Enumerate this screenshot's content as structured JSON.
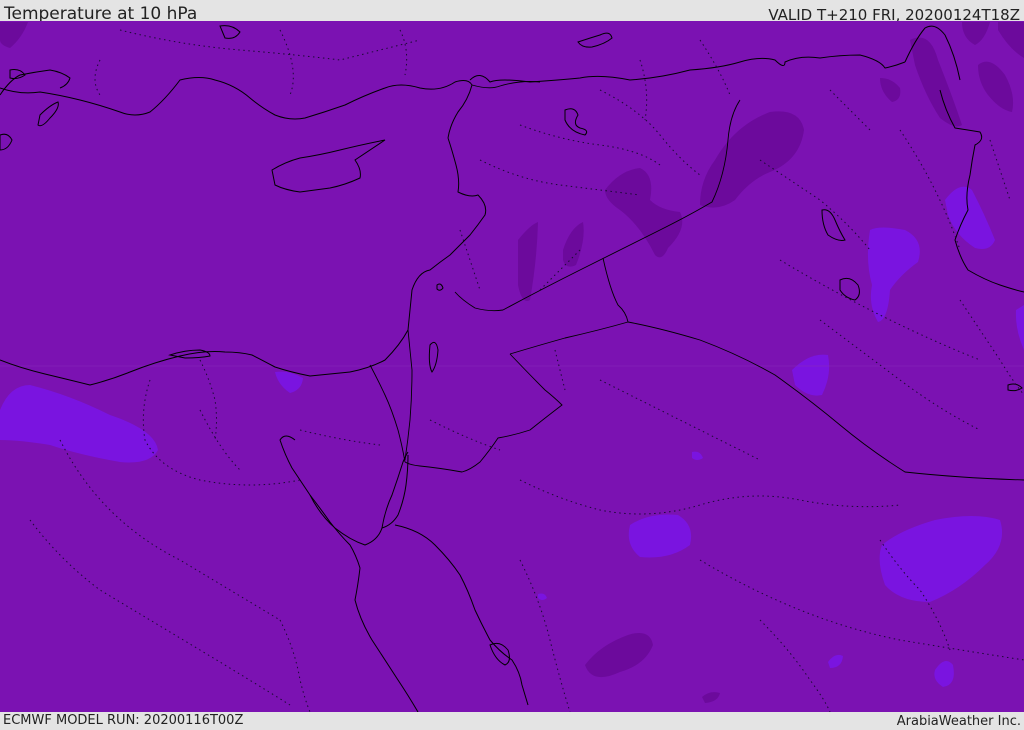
{
  "header": {
    "title": "Temperature at 10 hPa",
    "valid": "VALID T+210 FRI, 20200124T18Z"
  },
  "footer": {
    "model_run": "ECMWF MODEL RUN: 20200116T00Z",
    "credit": "ArabiaWeather Inc."
  },
  "colors": {
    "field_base": "#7b12b2",
    "field_warmer": "#6c0a9c",
    "field_colder": "#7a14e0",
    "coastline": "#000000",
    "boundary": "#000000",
    "frame": "#e4e4e4"
  }
}
